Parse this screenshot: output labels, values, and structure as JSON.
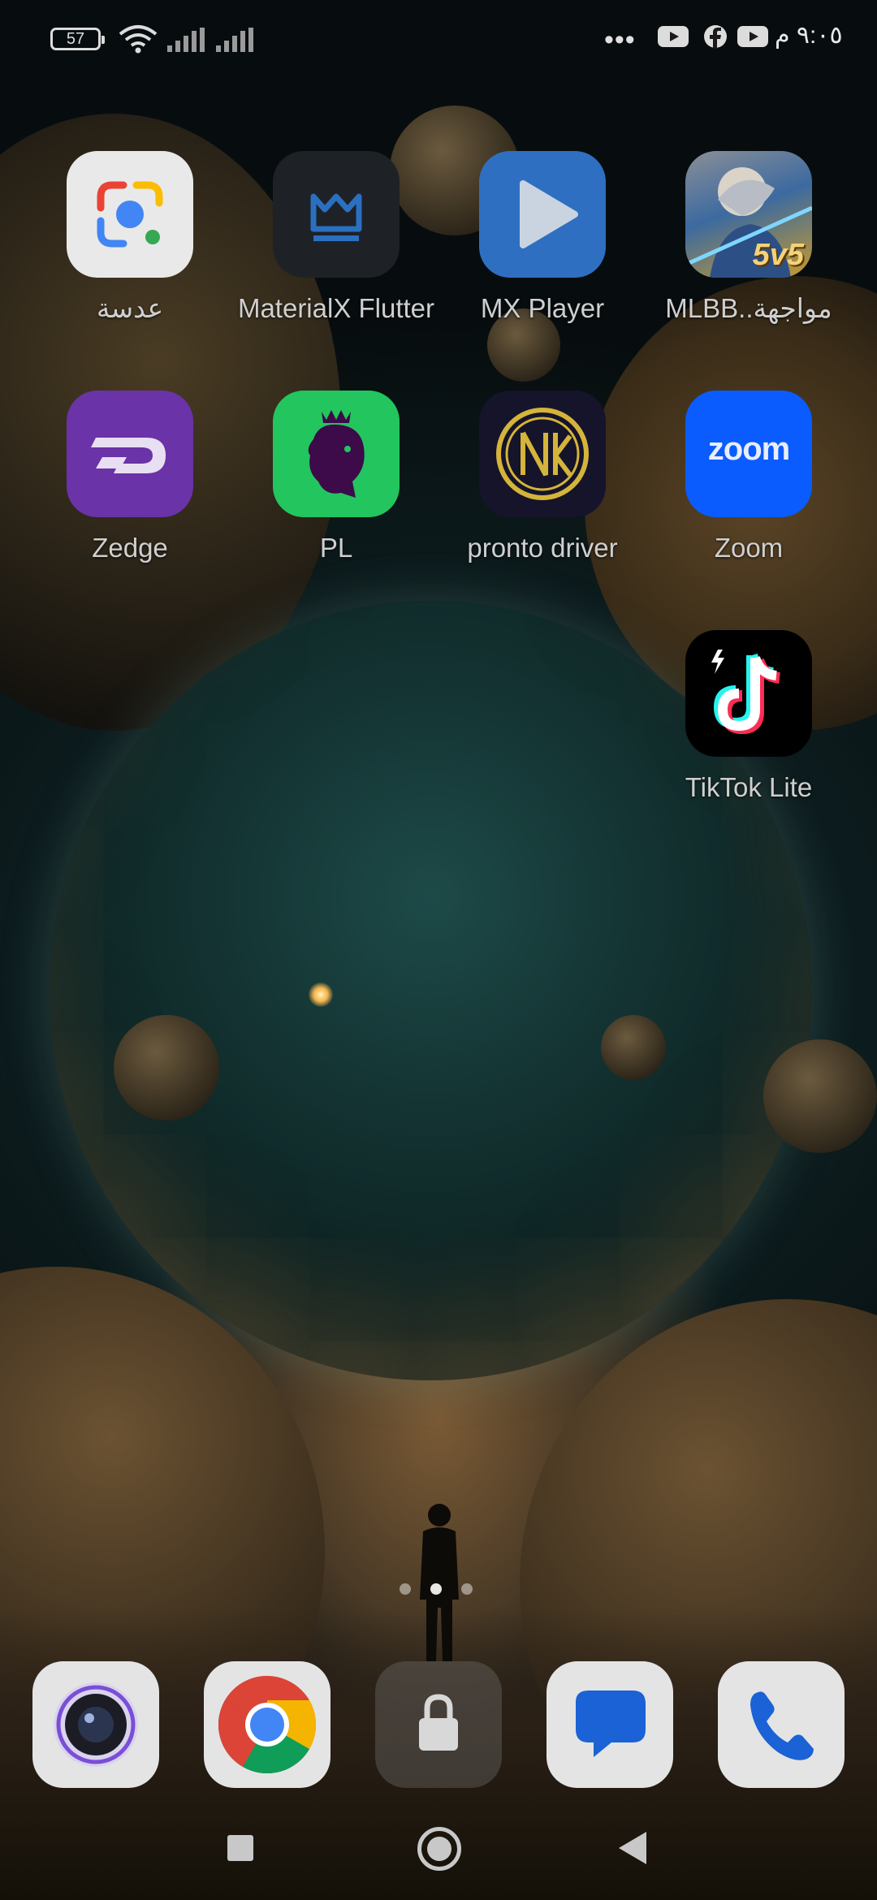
{
  "status_bar": {
    "battery_level": "57",
    "clock": "٩:٠٥ م",
    "overflow_dots": "•••",
    "notification_icons": [
      "youtube-icon",
      "facebook-icon",
      "youtube-icon"
    ]
  },
  "home_apps": [
    {
      "label": "عدسة",
      "icon": "google-lens-icon"
    },
    {
      "label": "MaterialX Flutter",
      "icon": "materialx-crown-icon"
    },
    {
      "label": "MX Player",
      "icon": "mx-player-icon"
    },
    {
      "label": "مواجهة..MLBB",
      "icon": "mlbb-5v5-icon"
    },
    {
      "label": "Zedge",
      "icon": "zedge-icon"
    },
    {
      "label": "PL",
      "icon": "premier-league-lion-icon"
    },
    {
      "label": "pronto driver",
      "icon": "pronto-driver-icon"
    },
    {
      "label": "Zoom",
      "icon": "zoom-icon"
    },
    {
      "label": "TikTok Lite",
      "icon": "tiktok-lite-icon"
    }
  ],
  "app_icon_text": {
    "zoom": "zoom",
    "mlbb": "5v5"
  },
  "pager": {
    "pages": 3,
    "current": 2
  },
  "dock": [
    {
      "icon": "camera-icon"
    },
    {
      "icon": "chrome-icon"
    },
    {
      "icon": "lock-icon"
    },
    {
      "icon": "messages-icon"
    },
    {
      "icon": "phone-icon"
    }
  ],
  "colors": {
    "mx_player": "#2f73c8",
    "zedge": "#6a33a8",
    "premier_league": "#22c55e",
    "zoom": "#0b5cff",
    "tiktok_bg": "#000000"
  }
}
